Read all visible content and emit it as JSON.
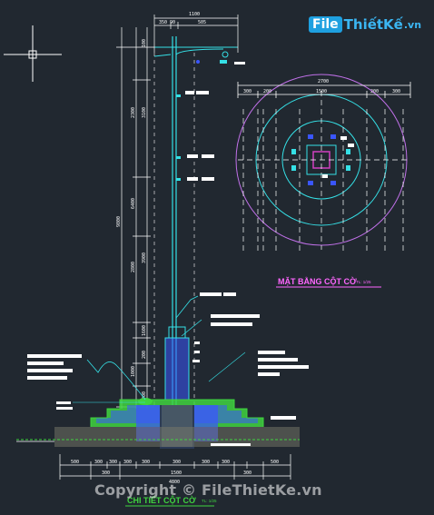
{
  "logo": {
    "box_text": "File",
    "rest_text": "ThiếtKế",
    "domain_text": ".vn"
  },
  "watermark": "Copyright © FileThietKe.vn",
  "plan": {
    "title": "MẶT BẰNG CỘT CỜ",
    "scale": "TL: 1/25"
  },
  "section": {
    "title": "CHI TIẾT CỘT CỜ",
    "scale": "TL: 1/25"
  },
  "dims": {
    "top_total": "1100",
    "top_a": "350",
    "top_b": "90",
    "top_c": "505",
    "plan_total": "2700",
    "plan_a": "300",
    "plan_b": "200",
    "plan_c": "1500",
    "left_full": "9800",
    "left_1": "2300",
    "left_2": "3100",
    "left_3": "6400",
    "left_4": "3900",
    "left_5": "2800",
    "left_6": "100",
    "left_7": "1600",
    "left_8": "200",
    "left_9": "1000",
    "left_10": "900",
    "bot_1": "500",
    "bot_2": "300",
    "bot_3": "300",
    "bot_4": "300",
    "bot_5": "300",
    "bot_6": "300",
    "bot_7": "300",
    "bot_8": "300",
    "bot_9": "500",
    "bot_mid": "1500",
    "bot_l": "300",
    "bot_r": "300",
    "bot_total": "4800"
  },
  "colors": {
    "bg": "#212830",
    "cyan": "#35e0e6",
    "magenta": "#c070e8",
    "green": "#3fd43f",
    "blue": "#3a56ff",
    "white": "#ffffff"
  }
}
